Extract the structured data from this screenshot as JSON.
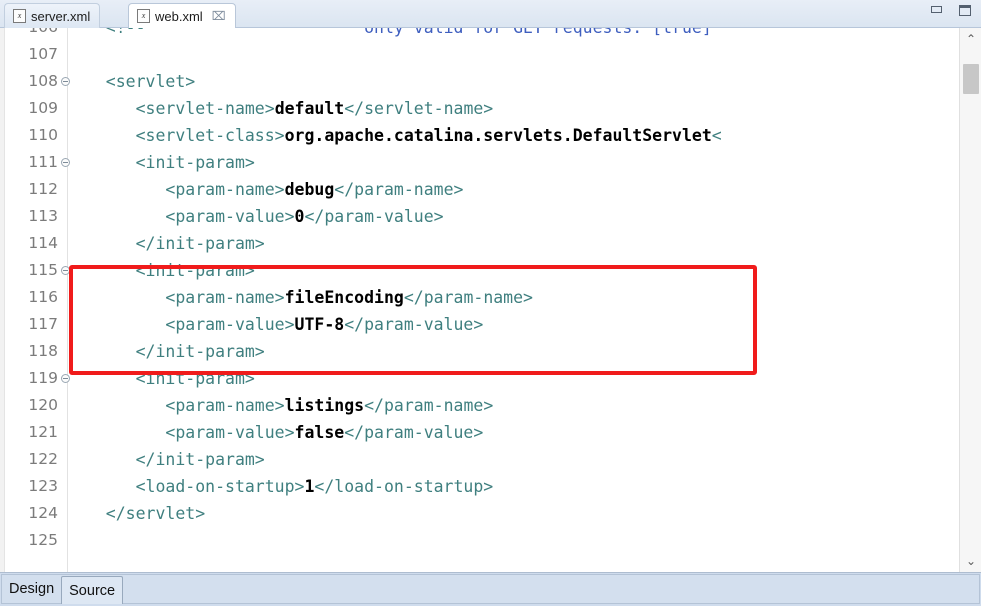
{
  "window": {
    "minimize_label": "minimize",
    "maximize_label": "maximize"
  },
  "tabs": [
    {
      "label": "server.xml",
      "icon": "xml-file-icon",
      "active": false,
      "closable": false
    },
    {
      "label": "web.xml",
      "icon": "xml-file-icon",
      "active": true,
      "closable": true,
      "close_glyph": "⌧"
    }
  ],
  "editor": {
    "first_line_number": 106,
    "last_line_number": 125,
    "scroll": {
      "v_up_glyph": "⌃",
      "v_down_glyph": "⌄",
      "h_left_glyph": "‹",
      "h_right_glyph": "›"
    },
    "highlight": {
      "type": "red-rectangle",
      "color": "#f01b1b",
      "from_line": 115,
      "to_line": 118
    },
    "lines": [
      {
        "no": "106",
        "fold": false,
        "clipped": true,
        "segments": [
          {
            "text": "   <!--                      ",
            "style": "tg"
          },
          {
            "text": "only valid for GET requests. [true]",
            "style": "cmt"
          }
        ]
      },
      {
        "no": "107",
        "fold": false,
        "segments": []
      },
      {
        "no": "108",
        "fold": true,
        "segments": [
          {
            "text": "   <servlet>",
            "style": "tg"
          }
        ]
      },
      {
        "no": "109",
        "fold": false,
        "segments": [
          {
            "text": "      <servlet-name>",
            "style": "tg"
          },
          {
            "text": "default",
            "style": "txt"
          },
          {
            "text": "</servlet-name>",
            "style": "tg"
          }
        ]
      },
      {
        "no": "110",
        "fold": false,
        "segments": [
          {
            "text": "      <servlet-class>",
            "style": "tg"
          },
          {
            "text": "org.apache.catalina.servlets.DefaultServlet",
            "style": "txt"
          },
          {
            "text": "<",
            "style": "tg"
          }
        ]
      },
      {
        "no": "111",
        "fold": true,
        "segments": [
          {
            "text": "      <init-param>",
            "style": "tg"
          }
        ]
      },
      {
        "no": "112",
        "fold": false,
        "segments": [
          {
            "text": "         <param-name>",
            "style": "tg"
          },
          {
            "text": "debug",
            "style": "txt"
          },
          {
            "text": "</param-name>",
            "style": "tg"
          }
        ]
      },
      {
        "no": "113",
        "fold": false,
        "segments": [
          {
            "text": "         <param-value>",
            "style": "tg"
          },
          {
            "text": "0",
            "style": "txt"
          },
          {
            "text": "</param-value>",
            "style": "tg"
          }
        ]
      },
      {
        "no": "114",
        "fold": false,
        "segments": [
          {
            "text": "      </init-param>",
            "style": "tg"
          }
        ]
      },
      {
        "no": "115",
        "fold": true,
        "segments": [
          {
            "text": "      <init-param>",
            "style": "tg"
          }
        ]
      },
      {
        "no": "116",
        "fold": false,
        "segments": [
          {
            "text": "         <param-name>",
            "style": "tg"
          },
          {
            "text": "fileEncoding",
            "style": "txt"
          },
          {
            "text": "</param-name>",
            "style": "tg"
          }
        ]
      },
      {
        "no": "117",
        "fold": false,
        "segments": [
          {
            "text": "         <param-value>",
            "style": "tg"
          },
          {
            "text": "UTF-8",
            "style": "txt"
          },
          {
            "text": "</param-value>",
            "style": "tg"
          }
        ]
      },
      {
        "no": "118",
        "fold": false,
        "segments": [
          {
            "text": "      </init-param>",
            "style": "tg"
          }
        ]
      },
      {
        "no": "119",
        "fold": true,
        "segments": [
          {
            "text": "      <init-param>",
            "style": "tg"
          }
        ]
      },
      {
        "no": "120",
        "fold": false,
        "segments": [
          {
            "text": "         <param-name>",
            "style": "tg"
          },
          {
            "text": "listings",
            "style": "txt"
          },
          {
            "text": "</param-name>",
            "style": "tg"
          }
        ]
      },
      {
        "no": "121",
        "fold": false,
        "segments": [
          {
            "text": "         <param-value>",
            "style": "tg"
          },
          {
            "text": "false",
            "style": "txt"
          },
          {
            "text": "</param-value>",
            "style": "tg"
          }
        ]
      },
      {
        "no": "122",
        "fold": false,
        "segments": [
          {
            "text": "      </init-param>",
            "style": "tg"
          }
        ]
      },
      {
        "no": "123",
        "fold": false,
        "segments": [
          {
            "text": "      <load-on-startup>",
            "style": "tg"
          },
          {
            "text": "1",
            "style": "txt"
          },
          {
            "text": "</load-on-startup>",
            "style": "tg"
          }
        ]
      },
      {
        "no": "124",
        "fold": false,
        "segments": [
          {
            "text": "   </servlet>",
            "style": "tg"
          }
        ]
      },
      {
        "no": "125",
        "fold": false,
        "segments": []
      }
    ]
  },
  "bottom_tabs": [
    {
      "label": "Design",
      "selected": false
    },
    {
      "label": "Source",
      "selected": true
    }
  ]
}
